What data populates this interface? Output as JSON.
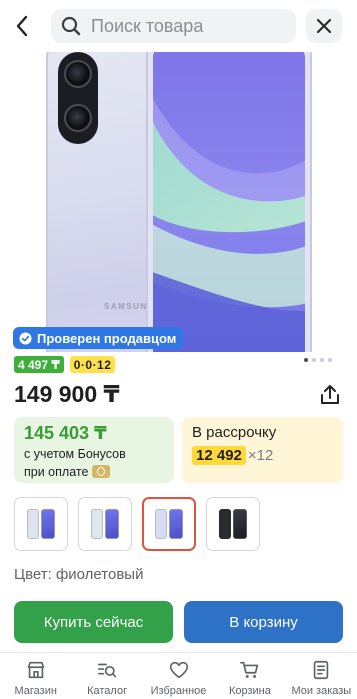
{
  "header": {
    "search_placeholder": "Поиск товара"
  },
  "gallery": {
    "brand_on_device": "SAMSUNG",
    "seller_badge": "Проверен продавцом",
    "image_count": 4,
    "active_image": 1
  },
  "badges": {
    "bonus": "4 497 ₸",
    "installment": "0·0·12"
  },
  "product": {
    "price": "149 900 ₸",
    "color_label": "Цвет: фиолетовый"
  },
  "bonus_card": {
    "amount": "145 403 ₸",
    "line1": "с учетом Бонусов",
    "line2": "при оплате"
  },
  "installment_card": {
    "title": "В рассрочку",
    "monthly": "12 492",
    "months": "×12"
  },
  "variants": [
    {
      "back": "#dfe3f0",
      "selected": false
    },
    {
      "back": "#dfe7ee",
      "selected": false
    },
    {
      "back": "#d9dbf2",
      "selected": true
    },
    {
      "back": "#2a2b30",
      "selected": false
    }
  ],
  "actions": {
    "buy_now": "Купить сейчас",
    "add_to_cart": "В корзину"
  },
  "tabbar": [
    {
      "label": "Магазин",
      "icon": "store-icon"
    },
    {
      "label": "Каталог",
      "icon": "catalog-search-icon"
    },
    {
      "label": "Избранное",
      "icon": "heart-icon"
    },
    {
      "label": "Корзина",
      "icon": "cart-icon"
    },
    {
      "label": "Мои заказы",
      "icon": "orders-icon"
    }
  ],
  "colors": {
    "accent_blue": "#2e72c8",
    "buy_green": "#33a04a",
    "bonus_green": "#3a9c34",
    "installment_yellow": "#ffd83a",
    "selected_border": "#e0533c"
  }
}
